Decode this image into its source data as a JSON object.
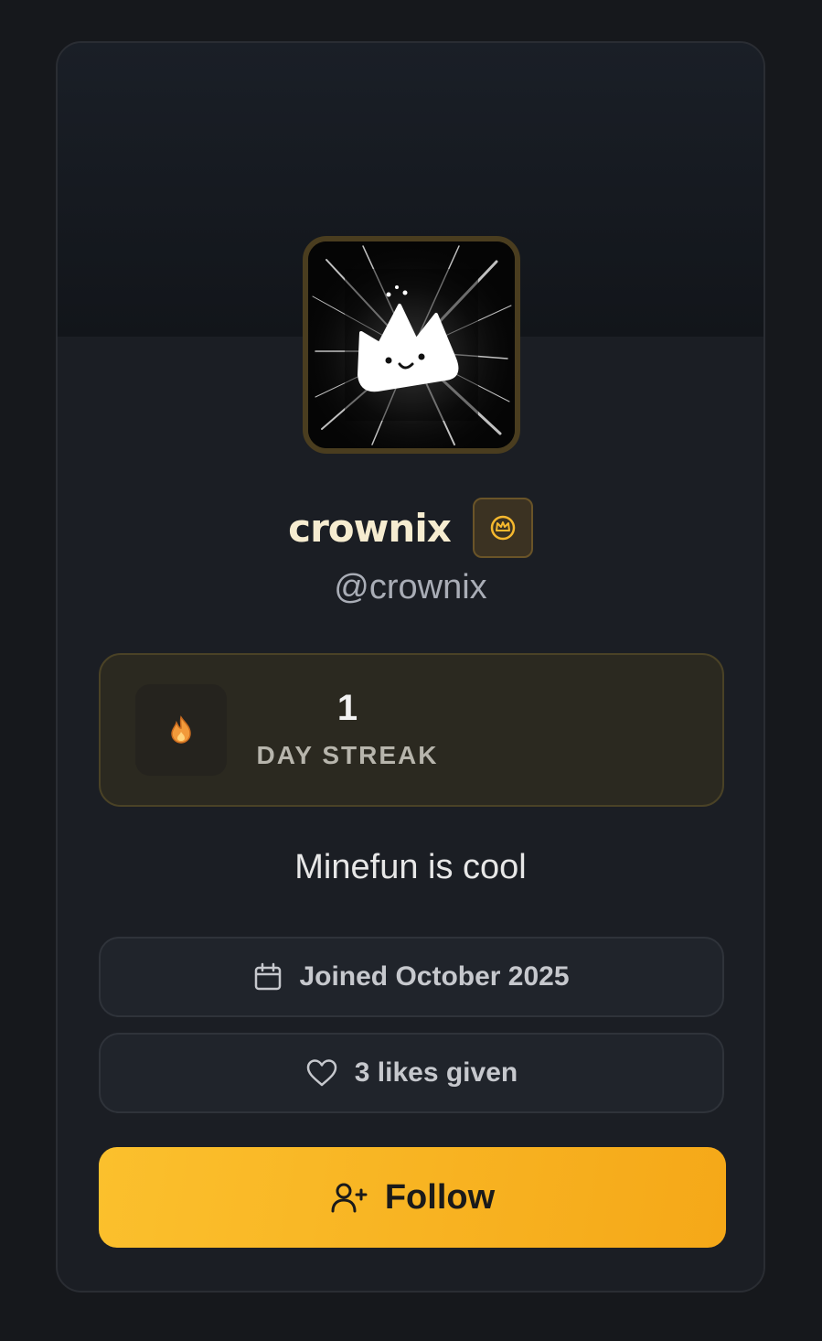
{
  "profile": {
    "display_name": "crownix",
    "handle": "@crownix",
    "bio": "Minefun is cool",
    "badge_icon": "crown-badge-icon",
    "avatar_icon": "crown-character-avatar"
  },
  "streak": {
    "count": "1",
    "label": "DAY STREAK",
    "icon": "fire-icon"
  },
  "stats": {
    "joined": "Joined October 2025",
    "joined_icon": "calendar-icon",
    "likes": "3 likes given",
    "likes_icon": "heart-icon"
  },
  "actions": {
    "follow_label": "Follow",
    "follow_icon": "user-plus-icon"
  },
  "colors": {
    "accent": "#fbc02d",
    "background": "#16181c",
    "card": "#1b1e24",
    "name": "#f6ecd0"
  }
}
